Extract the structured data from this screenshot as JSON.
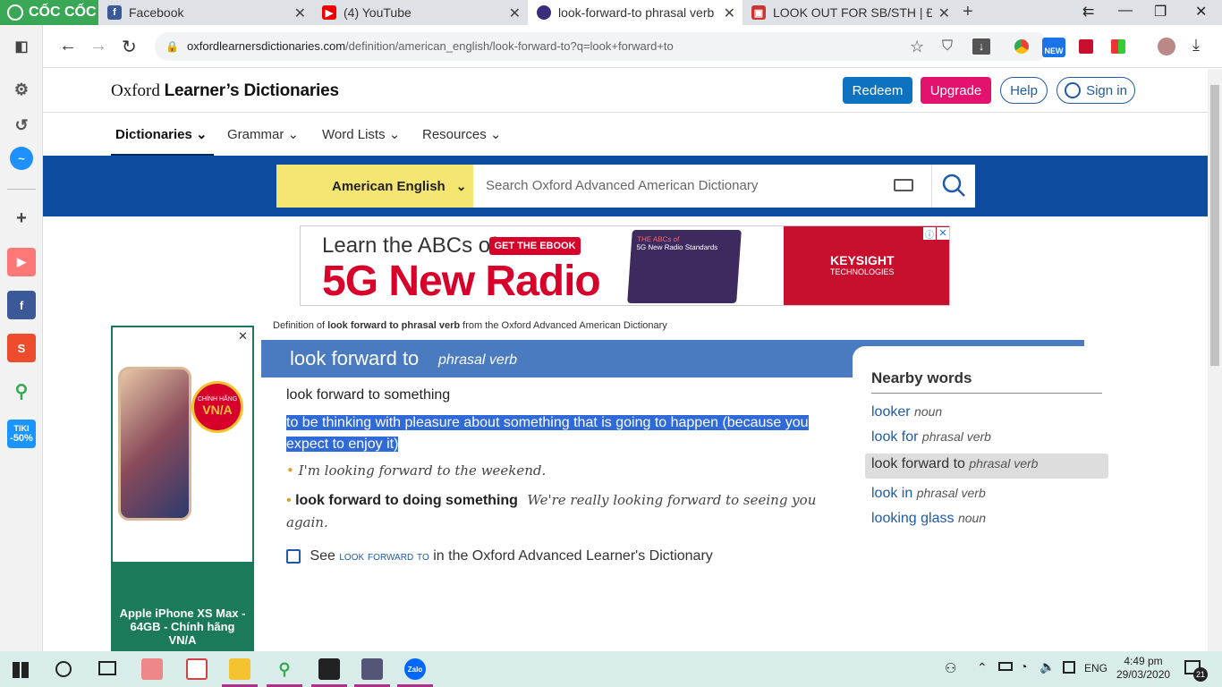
{
  "browser": {
    "brand": "CỐC CỐC",
    "tabs": [
      {
        "title": "Facebook"
      },
      {
        "title": "(4) YouTube"
      },
      {
        "title": "look-forward-to phrasal verb"
      },
      {
        "title": "LOOK OUT FOR SB/STH | Định"
      }
    ],
    "url_host": "oxfordlearnersdictionaries.com",
    "url_path": "/definition/american_english/look-forward-to?q=look+forward+to",
    "new_badge": "NEW"
  },
  "sidebar": {
    "tiki_label": "TIKI",
    "tiki_discount": "-50%"
  },
  "site": {
    "logo_regular": "Oxford",
    "logo_bold": "Learner’s Dictionaries",
    "buttons": {
      "redeem": "Redeem",
      "upgrade": "Upgrade",
      "help": "Help",
      "signin": "Sign in"
    },
    "nav": [
      "Dictionaries",
      "Grammar",
      "Word Lists",
      "Resources"
    ],
    "dictionary_selector": "American English",
    "search_placeholder": "Search Oxford Advanced American Dictionary"
  },
  "ad": {
    "line1": "Learn the ABCs of",
    "cta": "GET THE EBOOK",
    "line2": "5G New Radio",
    "ebook_small": "THE ABCs of",
    "ebook_title": "5G New Radio Standards",
    "brand": "KEYSIGHT",
    "brand_sub": "TECHNOLOGIES",
    "side_ad_badge1": "CHÍNH HÃNG",
    "side_ad_badge2": "VN/A",
    "side_ad_text": "Apple iPhone XS Max - 64GB - Chính hãng VN/A"
  },
  "entry": {
    "definition_of_prefix": "Definition of",
    "definition_of_word": "look forward to phrasal verb",
    "definition_of_suffix": "from the Oxford Advanced American Dictionary",
    "headword": "look forward to",
    "pos": "phrasal verb",
    "pattern": "look forward to something",
    "definition": "to be thinking with pleasure about something that is going to happen (because you expect to enjoy it)",
    "example1": "I'm looking forward to the weekend.",
    "pattern2": "look forward to doing something",
    "example2": "We're really looking forward to seeing you again.",
    "see_prefix": "See",
    "see_link": "look forward to",
    "see_suffix": "in the Oxford Advanced Learner's Dictionary"
  },
  "nearby": {
    "title": "Nearby words",
    "items": [
      {
        "word": "looker",
        "pos": "noun"
      },
      {
        "word": "look for",
        "pos": "phrasal verb"
      },
      {
        "word": "look forward to",
        "pos": "phrasal verb"
      },
      {
        "word": "look in",
        "pos": "phrasal verb"
      },
      {
        "word": "looking glass",
        "pos": "noun"
      }
    ]
  },
  "taskbar": {
    "language": "ENG",
    "time": "4:49 pm",
    "date": "29/03/2020",
    "zalo": "Zalo",
    "notifications": "21"
  },
  "colors": {
    "accent_blue": "#0d4c9e",
    "upgrade": "#e3126e",
    "redeem": "#0d73c1",
    "highlight": "#2f6ad8"
  }
}
